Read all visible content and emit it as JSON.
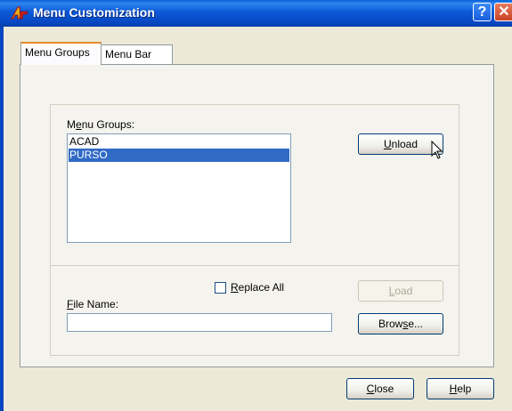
{
  "window": {
    "title": "Menu Customization",
    "help_glyph": "?",
    "close_glyph": "✕"
  },
  "tabs": [
    {
      "label": "Menu Groups",
      "active": true
    },
    {
      "label": "Menu Bar",
      "active": false
    }
  ],
  "menu_groups": {
    "label_pre": "M",
    "label_ul": "e",
    "label_post": "nu Groups:",
    "items": [
      {
        "text": "ACAD",
        "selected": false
      },
      {
        "text": "PURSO",
        "selected": true
      }
    ],
    "unload": {
      "pre": "",
      "ul": "U",
      "post": "nload"
    }
  },
  "replace_all": {
    "pre": "",
    "ul": "R",
    "post": "eplace All",
    "checked": false
  },
  "file_name": {
    "pre": "",
    "ul": "F",
    "post": "ile Name:",
    "value": ""
  },
  "load": {
    "pre": "",
    "ul": "L",
    "post": "oad",
    "disabled": true
  },
  "browse": {
    "pre": "Brow",
    "ul": "s",
    "post": "e..."
  },
  "close": {
    "pre": "",
    "ul": "C",
    "post": "lose"
  },
  "help": {
    "pre": "",
    "ul": "H",
    "post": "elp"
  },
  "colors": {
    "titlebar": "#0847c2",
    "selection": "#316ac5",
    "face": "#ece9d8",
    "tab_highlight": "#e68b2c"
  }
}
